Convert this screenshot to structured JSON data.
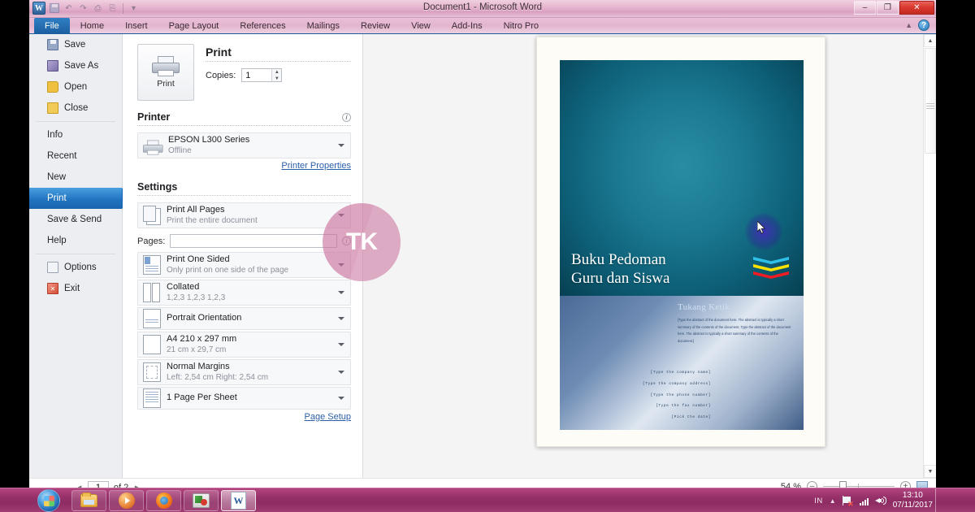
{
  "window": {
    "title": "Document1  -  Microsoft Word",
    "quick_access": [
      "word-icon",
      "save-icon",
      "undo-icon",
      "redo-icon",
      "print-preview-icon",
      "customize-icon"
    ],
    "controls": {
      "minimize": "–",
      "restore": "❐",
      "close": "✕"
    }
  },
  "ribbon": {
    "tabs": [
      {
        "label": "File",
        "active": true
      },
      {
        "label": "Home",
        "active": false
      },
      {
        "label": "Insert",
        "active": false
      },
      {
        "label": "Page Layout",
        "active": false
      },
      {
        "label": "References",
        "active": false
      },
      {
        "label": "Mailings",
        "active": false
      },
      {
        "label": "Review",
        "active": false
      },
      {
        "label": "View",
        "active": false
      },
      {
        "label": "Add-Ins",
        "active": false
      },
      {
        "label": "Nitro Pro",
        "active": false
      }
    ],
    "help": "?"
  },
  "nav": {
    "items": [
      {
        "label": "Save",
        "icon": "save-icon"
      },
      {
        "label": "Save As",
        "icon": "save-as-icon"
      },
      {
        "label": "Open",
        "icon": "open-folder-icon"
      },
      {
        "label": "Close",
        "icon": "close-folder-icon"
      },
      {
        "label": "Info",
        "icon": ""
      },
      {
        "label": "Recent",
        "icon": ""
      },
      {
        "label": "New",
        "icon": ""
      },
      {
        "label": "Print",
        "icon": ""
      },
      {
        "label": "Save & Send",
        "icon": ""
      },
      {
        "label": "Help",
        "icon": ""
      },
      {
        "label": "Options",
        "icon": "options-icon"
      },
      {
        "label": "Exit",
        "icon": "exit-icon"
      }
    ],
    "selected": "Print"
  },
  "print": {
    "button_label": "Print",
    "heading": "Print",
    "copies_label": "Copies:",
    "copies_value": "1",
    "printer_heading": "Printer",
    "printer_name": "EPSON L300 Series",
    "printer_status": "Offline",
    "printer_properties_link": "Printer Properties",
    "settings_heading": "Settings",
    "pages_label": "Pages:",
    "pages_value": "",
    "page_setup_link": "Page Setup",
    "settings": [
      {
        "title": "Print All Pages",
        "subtitle": "Print the entire document",
        "icon": "pages-icon"
      },
      {
        "title": "Print One Sided",
        "subtitle": "Only print on one side of the page",
        "icon": "one-sided-icon"
      },
      {
        "title": "Collated",
        "subtitle": "1,2,3   1,2,3   1,2,3",
        "icon": "collated-icon"
      },
      {
        "title": "Portrait Orientation",
        "subtitle": "",
        "icon": "orientation-icon"
      },
      {
        "title": "A4 210 x 297 mm",
        "subtitle": "21 cm x 29,7 cm",
        "icon": "paper-size-icon"
      },
      {
        "title": "Normal Margins",
        "subtitle": "Left:  2,54 cm    Right:  2,54 cm",
        "icon": "margins-icon"
      },
      {
        "title": "1 Page Per Sheet",
        "subtitle": "",
        "icon": "pages-per-sheet-icon"
      }
    ]
  },
  "document_preview": {
    "cover_title_line1": "Buku Pedoman",
    "cover_title_line2": "Guru dan Siswa",
    "subtitle": "Tukang Ketik",
    "abstract": "[Type the abstract of the document here. The abstract is typically a short summary of the contents of the document. Type the abstract of the document here. The abstract is typically a short summary of the contents of the document.]",
    "fields": [
      "[Type the company name]",
      "[Type the company address]",
      "[Type the phone number]",
      "[Type the fax number]",
      "[Pick the date]"
    ],
    "watermark_text": "TK",
    "chevron_colors": [
      "#2fc0e8",
      "#f7e200",
      "#ee1c25"
    ]
  },
  "status": {
    "page_current": "1",
    "page_of": "of 2",
    "prev": "◄",
    "next": "►",
    "zoom_level": "54 %",
    "zoom_out": "–",
    "zoom_in": "+"
  },
  "taskbar": {
    "start": "start-orb-icon",
    "apps": [
      {
        "name": "windows-explorer-icon",
        "active": false
      },
      {
        "name": "media-player-icon",
        "active": false
      },
      {
        "name": "firefox-icon",
        "active": false
      },
      {
        "name": "paint-icon",
        "active": false
      },
      {
        "name": "word-icon",
        "active": true
      }
    ],
    "tray": {
      "language": "IN",
      "time": "13:10",
      "date": "07/11/2017"
    }
  },
  "colors": {
    "accent_blue": "#2274c0",
    "titlebar_pink": "#e4b3cd",
    "taskbar_magenta": "#96306a",
    "cover_teal": "#1b7b93",
    "link_blue": "#2b5fa8"
  }
}
